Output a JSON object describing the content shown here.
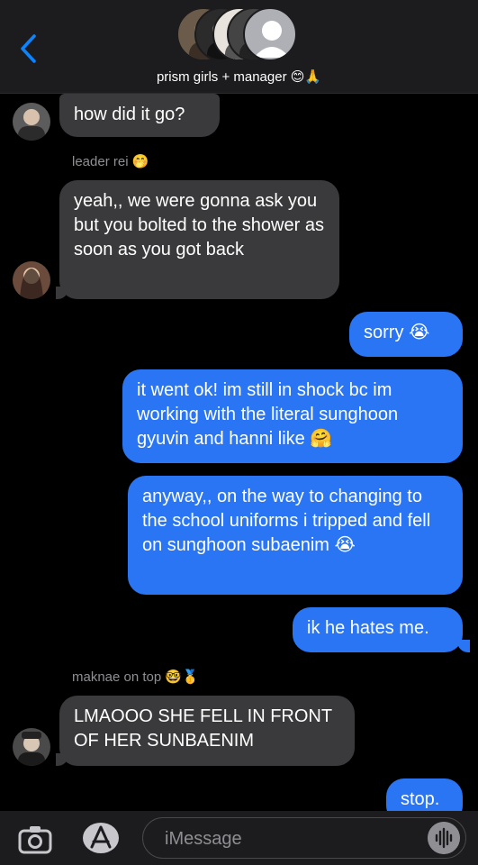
{
  "header": {
    "group_name": "prism girls + manager 😊🙏"
  },
  "messages": [
    {
      "id": "m1",
      "dir": "in",
      "text": "how did it go?"
    },
    {
      "id": "m2",
      "sender": "leader rei 🤭",
      "dir": "in",
      "text": "yeah,, we were gonna ask you but you bolted to the shower as soon as you got back"
    },
    {
      "id": "m3",
      "dir": "out",
      "text": "sorry 😭"
    },
    {
      "id": "m4",
      "dir": "out",
      "text": "it went ok! im still in shock bc im working with the literal sunghoon gyuvin and hanni like 🤗"
    },
    {
      "id": "m5",
      "dir": "out",
      "text": "anyway,, on the way to changing to the school uniforms i tripped and fell on sunghoon subaenim 😭"
    },
    {
      "id": "m6",
      "dir": "out",
      "text": "ik he hates me."
    },
    {
      "id": "m7",
      "sender": "maknae on top 🤓🥇",
      "dir": "in",
      "text": "LMAOOO SHE FELL IN FRONT OF HER SUNBAENIM"
    },
    {
      "id": "m8",
      "dir": "out",
      "text": "stop."
    }
  ],
  "composer": {
    "placeholder": "iMessage"
  },
  "colors": {
    "incoming": "#3a3a3c",
    "outgoing": "#2a75f3",
    "accent": "#0a84ff"
  },
  "icons": [
    "back-chevron-icon",
    "camera-icon",
    "app-store-icon",
    "audio-waveform-icon"
  ]
}
